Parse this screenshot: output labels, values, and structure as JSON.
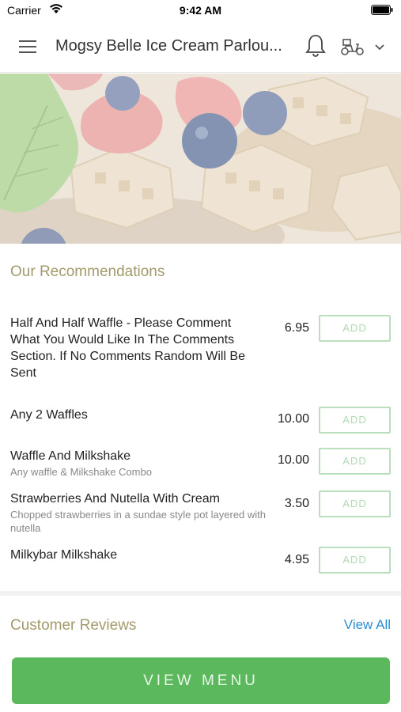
{
  "status_bar": {
    "carrier": "Carrier",
    "time": "9:42 AM"
  },
  "header": {
    "title": "Mogsy Belle Ice Cream Parlou..."
  },
  "recommendations": {
    "title": "Our Recommendations",
    "items": [
      {
        "name": "Half And Half Waffle - Please Comment What You Would Like In The Comments Section. If No Comments Random Will Be Sent",
        "description": "",
        "price": "6.95",
        "button": "ADD"
      },
      {
        "name": "Any 2 Waffles",
        "description": "",
        "price": "10.00",
        "button": "ADD"
      },
      {
        "name": "Waffle And Milkshake",
        "description": "Any waffle & Milkshake Combo",
        "price": "10.00",
        "button": "ADD"
      },
      {
        "name": "Strawberries And Nutella With Cream",
        "description": "Chopped strawberries in a sundae style pot layered with nutella",
        "price": "3.50",
        "button": "ADD"
      },
      {
        "name": "Milkybar Milkshake",
        "description": "",
        "price": "4.95",
        "button": "ADD"
      }
    ]
  },
  "reviews": {
    "title": "Customer Reviews",
    "view_all": "View All"
  },
  "footer": {
    "view_menu": "VIEW MENU"
  },
  "colors": {
    "accent_green": "#5cb85c",
    "link_blue": "#2a8fd0",
    "section_title": "#a39a6c",
    "add_border": "#b9dfbd"
  },
  "icons": [
    "wifi-icon",
    "battery-icon",
    "hamburger-menu-icon",
    "bell-icon",
    "scooter-icon",
    "chevron-down-icon"
  ]
}
